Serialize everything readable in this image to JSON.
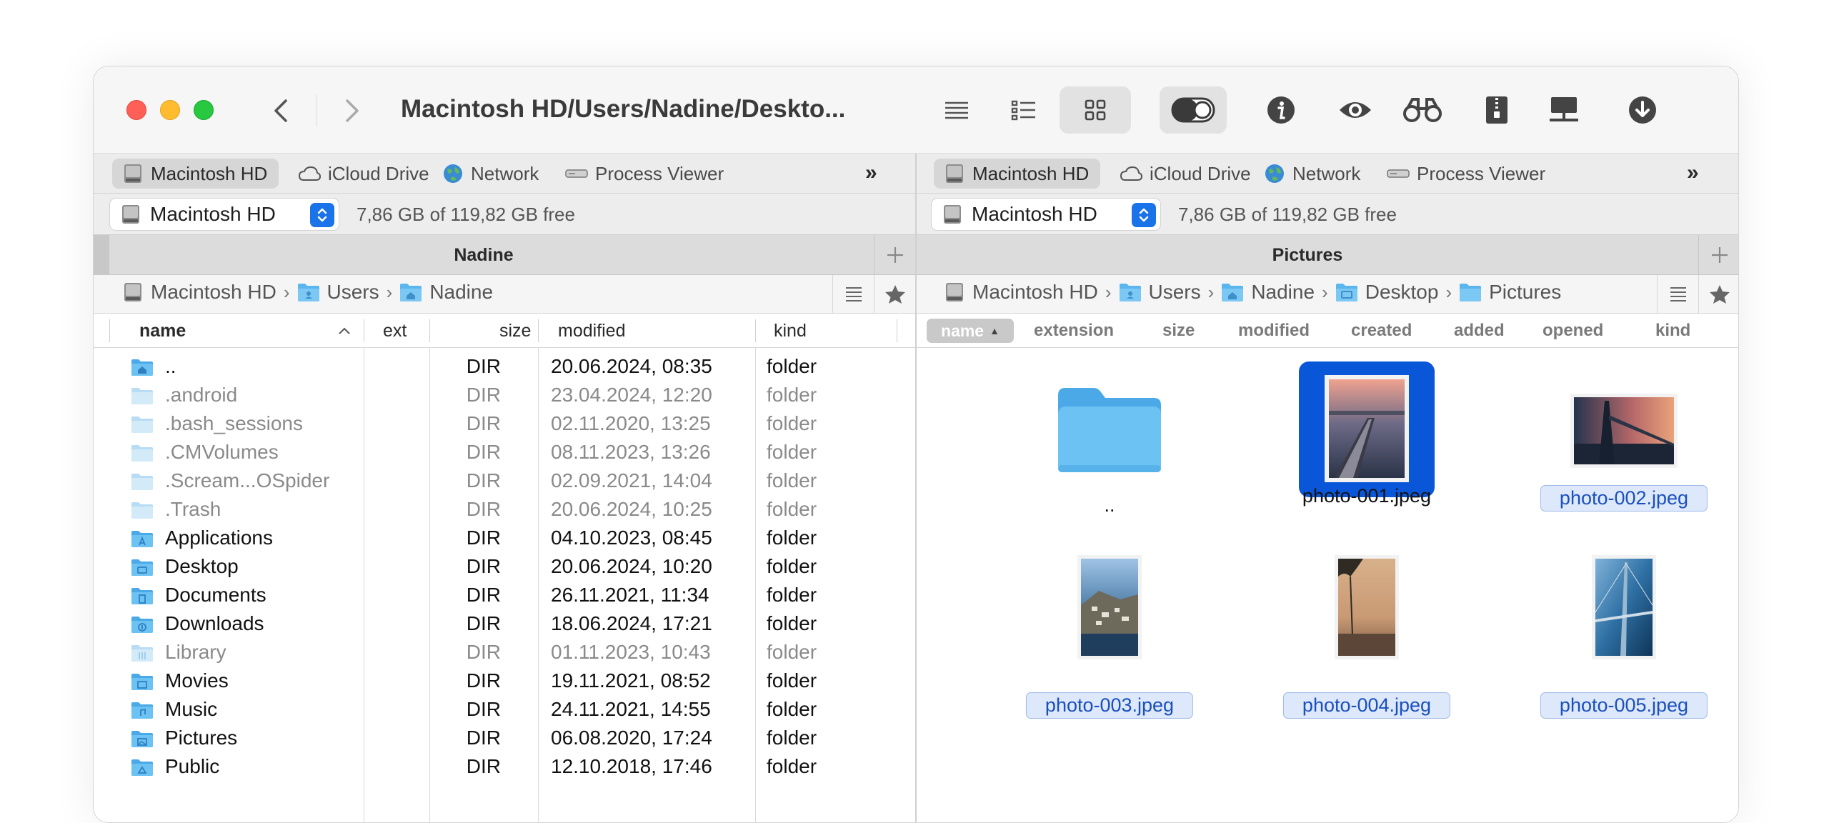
{
  "window": {
    "path_title": "Macintosh HD/Users/Nadine/Deskto..."
  },
  "toolbar": {
    "icons": [
      "list-view-icon",
      "detail-list-icon",
      "grid-view-icon",
      "toggle-icon",
      "info-icon",
      "eye-icon",
      "binoculars-icon",
      "archive-icon",
      "network-drive-icon",
      "download-icon"
    ]
  },
  "drive_tabs": [
    {
      "label": "Macintosh HD",
      "icon": "hard-drive-icon"
    },
    {
      "label": "iCloud Drive",
      "icon": "cloud-icon"
    },
    {
      "label": "Network",
      "icon": "globe-icon"
    },
    {
      "label": "Process Viewer",
      "icon": "drive-icon"
    }
  ],
  "more_tabs": "»",
  "volume": {
    "name": "Macintosh HD",
    "free": "7,86 GB of 119,82 GB free"
  },
  "left": {
    "title": "Nadine",
    "breadcrumb": [
      "Macintosh HD",
      "Users",
      "Nadine"
    ],
    "columns": {
      "name": "name",
      "ext": "ext",
      "size": "size",
      "modified": "modified",
      "kind": "kind"
    },
    "rows": [
      {
        "name": "..",
        "size": "DIR",
        "modified": "20.06.2024, 08:35",
        "kind": "folder",
        "hidden": false,
        "icon": "home-folder-icon"
      },
      {
        "name": ".android",
        "size": "DIR",
        "modified": "23.04.2024, 12:20",
        "kind": "folder",
        "hidden": true,
        "icon": "folder-icon"
      },
      {
        "name": ".bash_sessions",
        "size": "DIR",
        "modified": "02.11.2020, 13:25",
        "kind": "folder",
        "hidden": true,
        "icon": "folder-icon"
      },
      {
        "name": ".CMVolumes",
        "size": "DIR",
        "modified": "08.11.2023, 13:26",
        "kind": "folder",
        "hidden": true,
        "icon": "folder-icon"
      },
      {
        "name": ".Scream...OSpider",
        "size": "DIR",
        "modified": "02.09.2021, 14:04",
        "kind": "folder",
        "hidden": true,
        "icon": "folder-icon"
      },
      {
        "name": ".Trash",
        "size": "DIR",
        "modified": "20.06.2024, 10:25",
        "kind": "folder",
        "hidden": true,
        "icon": "folder-icon"
      },
      {
        "name": "Applications",
        "size": "DIR",
        "modified": "04.10.2023, 08:45",
        "kind": "folder",
        "hidden": false,
        "icon": "applications-folder-icon"
      },
      {
        "name": "Desktop",
        "size": "DIR",
        "modified": "20.06.2024, 10:20",
        "kind": "folder",
        "hidden": false,
        "icon": "desktop-folder-icon"
      },
      {
        "name": "Documents",
        "size": "DIR",
        "modified": "26.11.2021, 11:34",
        "kind": "folder",
        "hidden": false,
        "icon": "documents-folder-icon"
      },
      {
        "name": "Downloads",
        "size": "DIR",
        "modified": "18.06.2024, 17:21",
        "kind": "folder",
        "hidden": false,
        "icon": "downloads-folder-icon"
      },
      {
        "name": "Library",
        "size": "DIR",
        "modified": "01.11.2023, 10:43",
        "kind": "folder",
        "hidden": true,
        "icon": "library-folder-icon"
      },
      {
        "name": "Movies",
        "size": "DIR",
        "modified": "19.11.2021, 08:52",
        "kind": "folder",
        "hidden": false,
        "icon": "movies-folder-icon"
      },
      {
        "name": "Music",
        "size": "DIR",
        "modified": "24.11.2021, 14:55",
        "kind": "folder",
        "hidden": false,
        "icon": "music-folder-icon"
      },
      {
        "name": "Pictures",
        "size": "DIR",
        "modified": "06.08.2020, 17:24",
        "kind": "folder",
        "hidden": false,
        "icon": "pictures-folder-icon"
      },
      {
        "name": "Public",
        "size": "DIR",
        "modified": "12.10.2018, 17:46",
        "kind": "folder",
        "hidden": false,
        "icon": "public-folder-icon"
      }
    ]
  },
  "right": {
    "title": "Pictures",
    "breadcrumb": [
      "Macintosh HD",
      "Users",
      "Nadine",
      "Desktop",
      "Pictures"
    ],
    "columns": {
      "name": "name",
      "extension": "extension",
      "size": "size",
      "modified": "modified",
      "created": "created",
      "added": "added",
      "opened": "opened",
      "kind": "kind"
    },
    "sort_indicator": "▲",
    "tiles": [
      {
        "label": "..",
        "type": "folder",
        "selected": false,
        "focused": false
      },
      {
        "label": "photo-001.jpeg",
        "type": "photo-portrait",
        "selected": false,
        "focused": true
      },
      {
        "label": "photo-002.jpeg",
        "type": "photo-landscape",
        "selected": true,
        "focused": false
      },
      {
        "label": "photo-003.jpeg",
        "type": "photo-portrait",
        "selected": true,
        "focused": false
      },
      {
        "label": "photo-004.jpeg",
        "type": "photo-portrait",
        "selected": true,
        "focused": false
      },
      {
        "label": "photo-005.jpeg",
        "type": "photo-portrait",
        "selected": true,
        "focused": false
      }
    ]
  },
  "colors": {
    "accent": "#1a73e8",
    "selection_fill": "#dde8fb",
    "selection_text": "#1a4fbf",
    "focus_tile": "#0a56d8",
    "folder_blue": "#5bb6ee"
  }
}
